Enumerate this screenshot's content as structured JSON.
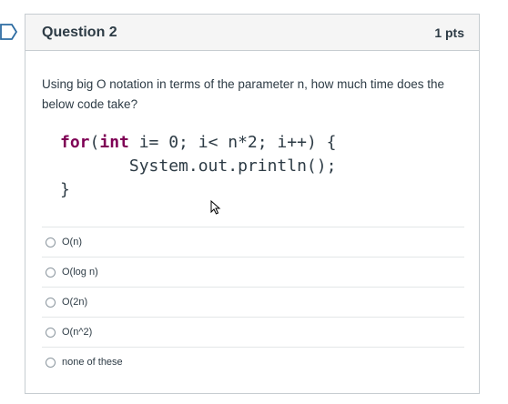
{
  "question": {
    "title": "Question 2",
    "points": "1 pts",
    "text": "Using big O notation in terms of the parameter n, how much time does the below code take?",
    "code": {
      "line1_kw1": "for",
      "line1_mid1": "(",
      "line1_kw2": "int",
      "line1_rest": " i= 0; i< n*2; i++) {",
      "line2": "       System.out.println();",
      "line3": "}"
    }
  },
  "answers": [
    {
      "label": "O(n)"
    },
    {
      "label": "O(log n)"
    },
    {
      "label": "O(2n)"
    },
    {
      "label": "O(n^2)"
    },
    {
      "label": "none of these"
    }
  ],
  "colors": {
    "keyword": "#7f0055",
    "text": "#2d3b45",
    "header_bg": "#f5f5f5"
  },
  "icons": {
    "flag": "bookmark-flag-icon",
    "cursor": "mouse-pointer-icon"
  }
}
